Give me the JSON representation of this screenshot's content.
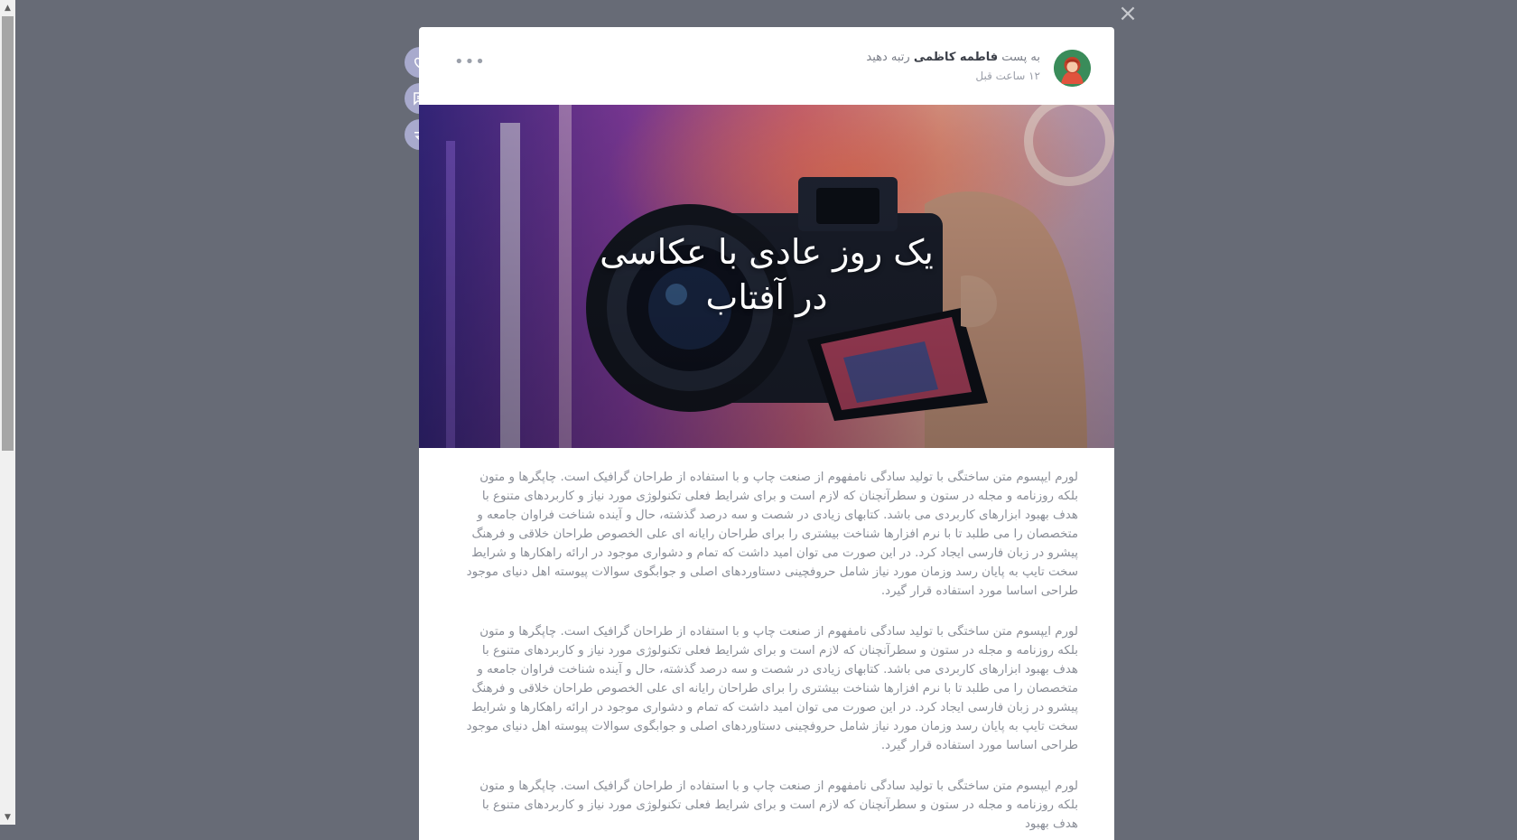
{
  "post": {
    "prefix": "به پست",
    "author": "فاطمه کاظمی",
    "suffix": "رتبه دهید",
    "time": "۱۲ ساعت قبل",
    "more": "•••",
    "title_line1": "یک روز عادی با عکاسی",
    "title_line2": "در آفتاب"
  },
  "body": {
    "paragraphs": [
      "لورم ایپسوم متن ساختگی با تولید سادگی نامفهوم از صنعت چاپ و با استفاده از طراحان گرافیک است. چاپگرها و متون بلکه روزنامه و مجله در ستون و سطرآنچنان که لازم است و برای شرایط فعلی تکنولوژی مورد نیاز و کاربردهای متنوع با هدف بهبود ابزارهای کاربردی می باشد. کتابهای زیادی در شصت و سه درصد گذشته، حال و آینده شناخت فراوان جامعه و متخصصان را می طلبد تا با نرم افزارها شناخت بیشتری را برای طراحان رایانه ای علی الخصوص طراحان خلاقی و فرهنگ پیشرو در زبان فارسی ایجاد کرد. در این صورت می توان امید داشت که تمام و دشواری موجود در ارائه راهکارها و شرایط سخت تایپ به پایان رسد وزمان مورد نیاز شامل حروفچینی دستاوردهای اصلی و جوابگوی سوالات پیوسته اهل دنیای موجود طراحی اساسا مورد استفاده قرار گیرد.",
      "لورم ایپسوم متن ساختگی با تولید سادگی نامفهوم از صنعت چاپ و با استفاده از طراحان گرافیک است. چاپگرها و متون بلکه روزنامه و مجله در ستون و سطرآنچنان که لازم است و برای شرایط فعلی تکنولوژی مورد نیاز و کاربردهای متنوع با هدف بهبود ابزارهای کاربردی می باشد. کتابهای زیادی در شصت و سه درصد گذشته، حال و آینده شناخت فراوان جامعه و متخصصان را می طلبد تا با نرم افزارها شناخت بیشتری را برای طراحان رایانه ای علی الخصوص طراحان خلاقی و فرهنگ پیشرو در زبان فارسی ایجاد کرد. در این صورت می توان امید داشت که تمام و دشواری موجود در ارائه راهکارها و شرایط سخت تایپ به پایان رسد وزمان مورد نیاز شامل حروفچینی دستاوردهای اصلی و جوابگوی سوالات پیوسته اهل دنیای موجود طراحی اساسا مورد استفاده قرار گیرد.",
      "لورم ایپسوم متن ساختگی با تولید سادگی نامفهوم از صنعت چاپ و با استفاده از طراحان گرافیک است. چاپگرها و متون بلکه روزنامه و مجله در ستون و سطرآنچنان که لازم است و برای شرایط فعلی تکنولوژی مورد نیاز و کاربردهای متنوع با هدف بهبود"
    ]
  },
  "actions": {
    "icons": [
      "heart-icon",
      "comment-icon",
      "share-icon"
    ]
  },
  "colors": {
    "overlay": "#676b76",
    "action_button": "#a8aacd",
    "body_text": "#8a8e97"
  }
}
